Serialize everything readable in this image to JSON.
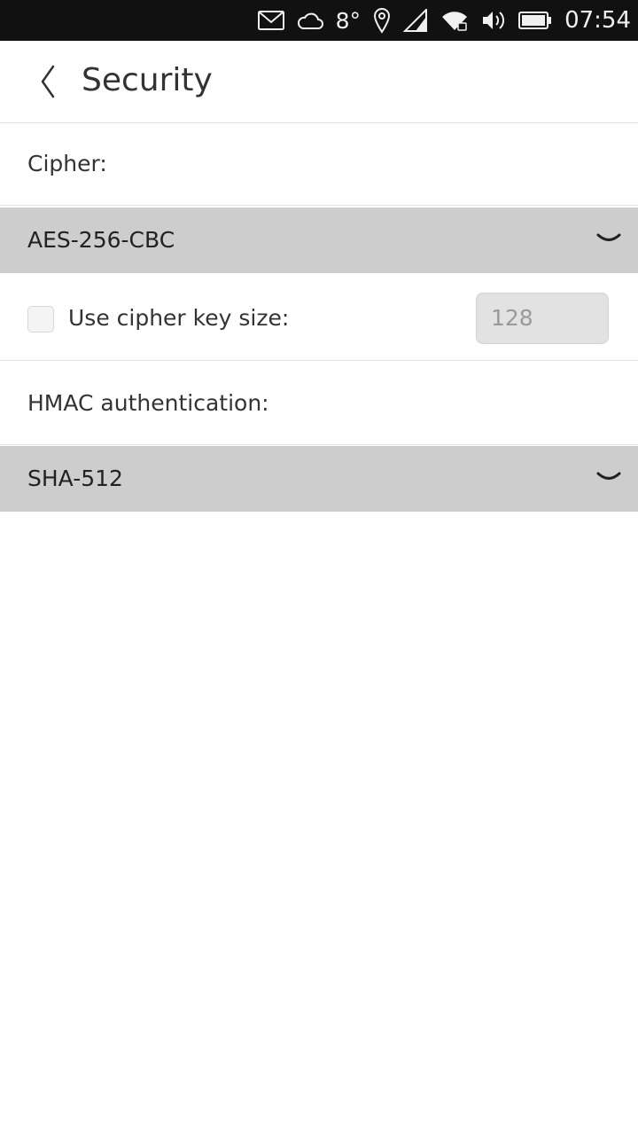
{
  "status_bar": {
    "temperature": "8°",
    "time": "07:54",
    "icons": [
      "mail-icon",
      "cloud-icon",
      "location-icon",
      "signal-icon",
      "wifi-icon",
      "volume-icon",
      "battery-icon"
    ]
  },
  "header": {
    "title": "Security"
  },
  "cipher": {
    "label": "Cipher:",
    "selected": "AES-256-CBC"
  },
  "key_size": {
    "checkbox_label": "Use cipher key size:",
    "checked": false,
    "value": "128"
  },
  "hmac": {
    "label": "HMAC authentication:",
    "selected": "SHA-512"
  },
  "colors": {
    "status_bar_bg": "#111111",
    "dropdown_bg": "#cdcdcd",
    "input_bg": "#e2e2e2",
    "text": "#333333"
  }
}
